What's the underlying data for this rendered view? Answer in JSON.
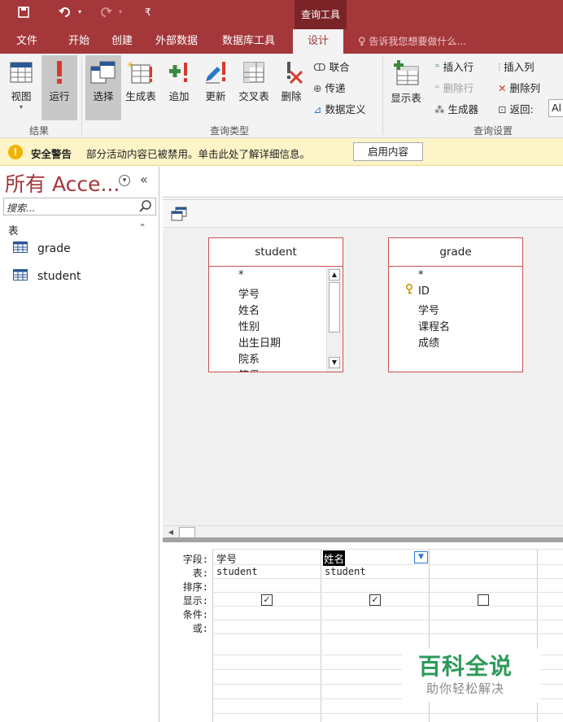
{
  "titlebar": {
    "context_tool": "查询工具",
    "qat_overflow": "₹"
  },
  "tabs": [
    "文件",
    "开始",
    "创建",
    "外部数据",
    "数据库工具",
    "设计"
  ],
  "active_tab": "设计",
  "tellme": "告诉我您想要做什么...",
  "ribbon": {
    "results": {
      "view": "视图",
      "run": "运行",
      "label": "结果"
    },
    "query_type": {
      "select": "选择",
      "make_table": "生成表",
      "append": "追加",
      "update": "更新",
      "crosstab": "交叉表",
      "delete": "删除",
      "union": "联合",
      "passthrough": "传递",
      "data_definition": "数据定义",
      "label": "查询类型"
    },
    "query_setup": {
      "show_table": "显示表",
      "insert_rows": "插入行",
      "delete_rows": "删除行",
      "builder": "生成器",
      "insert_columns": "插入列",
      "delete_columns": "删除列",
      "return": "返回:",
      "return_value": "Al",
      "label": "查询设置"
    }
  },
  "security_bar": {
    "title": "安全警告",
    "message": "部分活动内容已被禁用。单击此处了解详细信息。",
    "button": "启用内容"
  },
  "nav": {
    "title": "所有 Acce...",
    "search_placeholder": "搜索...",
    "section": "表",
    "items": [
      "grade",
      "student"
    ]
  },
  "tables": [
    {
      "name": "student",
      "fields": [
        "*",
        "学号",
        "姓名",
        "性别",
        "出生日期",
        "院系",
        "籍贯"
      ]
    },
    {
      "name": "grade",
      "fields": [
        "*",
        "ID",
        "学号",
        "课程名",
        "成绩"
      ]
    }
  ],
  "grid": {
    "row_labels": [
      "字段:",
      "表:",
      "排序:",
      "显示:",
      "条件:",
      "或:"
    ],
    "columns": [
      {
        "field": "学号",
        "table": "student",
        "show": true
      },
      {
        "field": "姓名",
        "table": "student",
        "show": true
      },
      {
        "field": "",
        "table": "",
        "show": false
      }
    ]
  },
  "watermark": {
    "main": "百科全说",
    "sub": "助你轻松解决"
  },
  "colors": {
    "brand": "#a4373a",
    "security_bar": "#fdf5c8",
    "watermark": "#2c9a59"
  }
}
